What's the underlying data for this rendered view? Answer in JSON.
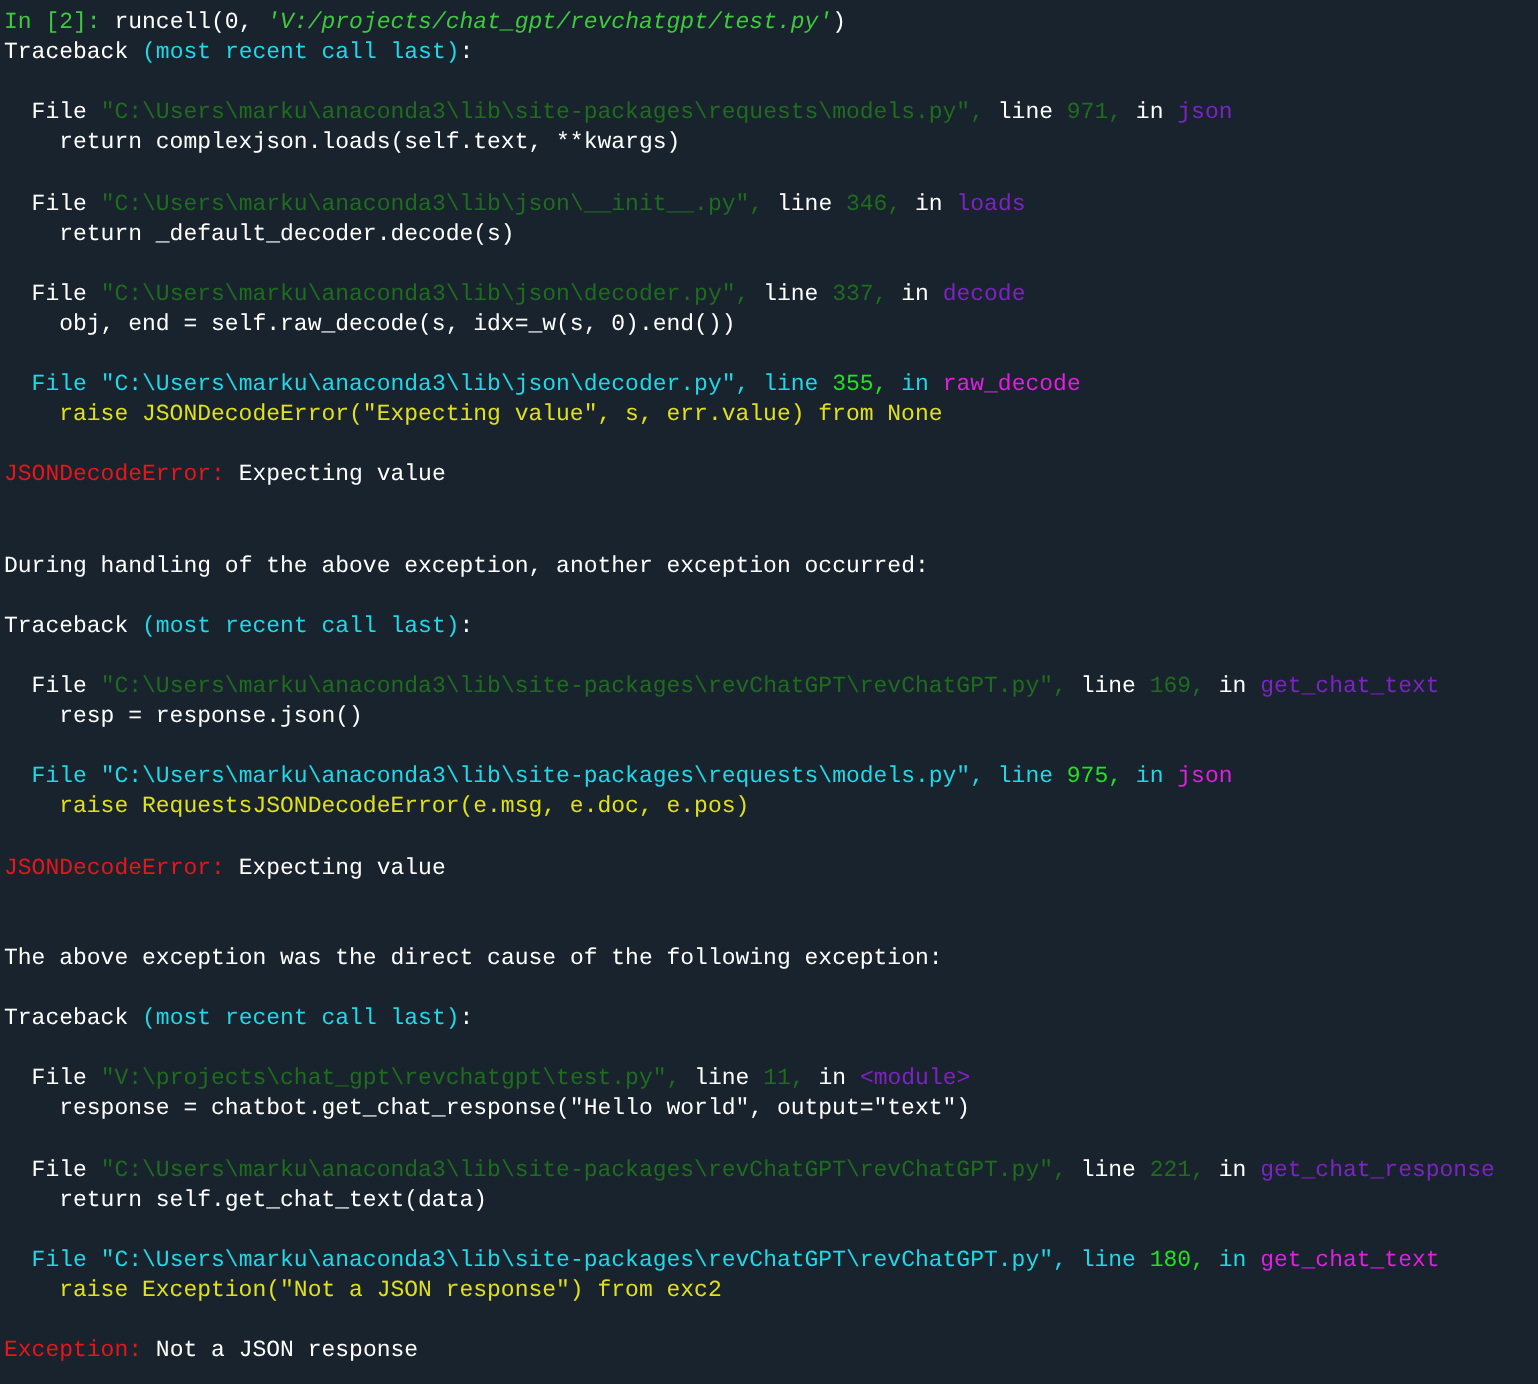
{
  "console": [
    {
      "kind": "prompt",
      "label": "In [2]:",
      "call": "runcell(0,",
      "argument": "'V:/projects/chat_gpt/revchatgpt/test.py'",
      "close": ")"
    },
    {
      "kind": "traceback",
      "label": "Traceback",
      "note": "(most recent call last)",
      "suffix": ":"
    },
    {
      "kind": "frame",
      "file": "File",
      "path": "\"C:\\Users\\marku\\anaconda3\\lib\\site-packages\\requests\\models.py\",",
      "line_label": "line",
      "line": "971,",
      "in_label": "in",
      "func": "json",
      "source": "return complexjson.loads(self.text, **kwargs)"
    },
    {
      "kind": "frame",
      "file": "File",
      "path": "\"C:\\Users\\marku\\anaconda3\\lib\\json\\__init__.py\",",
      "line_label": "line",
      "line": "346,",
      "in_label": "in",
      "func": "loads",
      "source": "return _default_decoder.decode(s)"
    },
    {
      "kind": "frame",
      "file": "File",
      "path": "\"C:\\Users\\marku\\anaconda3\\lib\\json\\decoder.py\",",
      "line_label": "line",
      "line": "337,",
      "in_label": "in",
      "func": "decode",
      "source": "obj, end = self.raw_decode(s, idx=_w(s, 0).end())"
    },
    {
      "kind": "raising-frame",
      "file": "File",
      "path": "\"C:\\Users\\marku\\anaconda3\\lib\\json\\decoder.py\",",
      "line_label": "line",
      "line": "355,",
      "in_label": "in",
      "func": "raw_decode",
      "source": "raise JSONDecodeError(\"Expecting value\", s, err.value) from None"
    },
    {
      "kind": "error",
      "name": "JSONDecodeError:",
      "message": "Expecting value"
    },
    {
      "kind": "chain",
      "text": "During handling of the above exception, another exception occurred:"
    },
    {
      "kind": "traceback",
      "label": "Traceback",
      "note": "(most recent call last)",
      "suffix": ":"
    },
    {
      "kind": "frame",
      "file": "File",
      "path": "\"C:\\Users\\marku\\anaconda3\\lib\\site-packages\\revChatGPT\\revChatGPT.py\",",
      "line_label": "line",
      "line": "169,",
      "in_label": "in",
      "func": "get_chat_text",
      "source": "resp = response.json()"
    },
    {
      "kind": "raising-frame",
      "file": "File",
      "path": "\"C:\\Users\\marku\\anaconda3\\lib\\site-packages\\requests\\models.py\",",
      "line_label": "line",
      "line": "975,",
      "in_label": "in",
      "func": "json",
      "source": "raise RequestsJSONDecodeError(e.msg, e.doc, e.pos)"
    },
    {
      "kind": "error",
      "name": "JSONDecodeError:",
      "message": "Expecting value"
    },
    {
      "kind": "chain",
      "text": "The above exception was the direct cause of the following exception:"
    },
    {
      "kind": "traceback",
      "label": "Traceback",
      "note": "(most recent call last)",
      "suffix": ":"
    },
    {
      "kind": "frame",
      "file": "File",
      "path": "\"V:\\projects\\chat_gpt\\revchatgpt\\test.py\",",
      "line_label": "line",
      "line": "11,",
      "in_label": "in",
      "func": "<module>",
      "source": "response = chatbot.get_chat_response(\"Hello world\", output=\"text\")"
    },
    {
      "kind": "frame",
      "file": "File",
      "path": "\"C:\\Users\\marku\\anaconda3\\lib\\site-packages\\revChatGPT\\revChatGPT.py\",",
      "line_label": "line",
      "line": "221,",
      "in_label": "in",
      "func": "get_chat_response",
      "source": "return self.get_chat_text(data)"
    },
    {
      "kind": "raising-frame",
      "file": "File",
      "path": "\"C:\\Users\\marku\\anaconda3\\lib\\site-packages\\revChatGPT\\revChatGPT.py\",",
      "line_label": "line",
      "line": "180,",
      "in_label": "in",
      "func": "get_chat_text",
      "source": "raise Exception(\"Not a JSON response\") from exc2"
    },
    {
      "kind": "error",
      "name": "Exception:",
      "message": "Not a JSON response"
    }
  ]
}
